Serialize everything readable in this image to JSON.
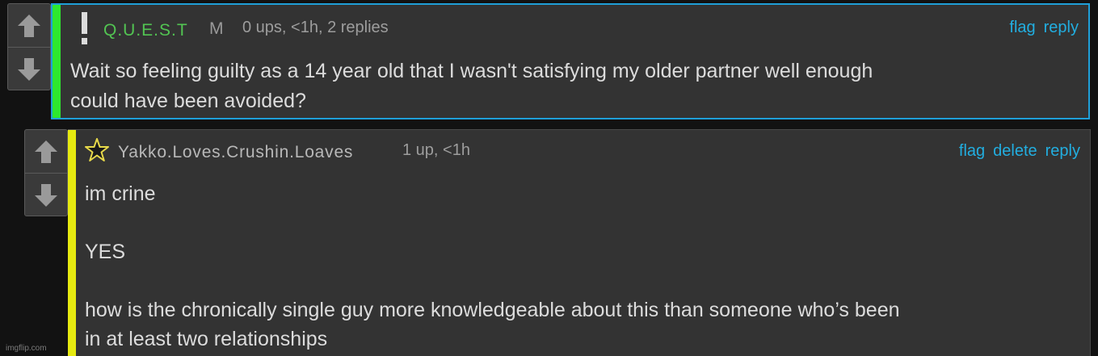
{
  "comments": [
    {
      "username": "Q.U.E.S.T",
      "flair": "M",
      "stats": "0 ups, <1h, 2 replies",
      "actions": [
        "flag",
        "reply"
      ],
      "text": "Wait so feeling guilty as a 14 year old that I wasn't satisfying my older partner well enough\ncould have been avoided?",
      "badge_icon": "exclamation-icon",
      "bar_color": "#2ee82e"
    },
    {
      "username": "Yakko.Loves.Crushin.Loaves",
      "stats": "1 up, <1h",
      "actions": [
        "flag",
        "delete",
        "reply"
      ],
      "text": "im crine\n\nYES\n\nhow is the chronically single guy more knowledgeable about this than someone who’s been\nin at least two relationships",
      "badge_icon": "star-icon",
      "bar_color": "#e6ea10"
    }
  ],
  "watermark": "imgflip.com",
  "colors": {
    "accent": "#22aee0",
    "highlight_border": "#1f9fd8"
  }
}
